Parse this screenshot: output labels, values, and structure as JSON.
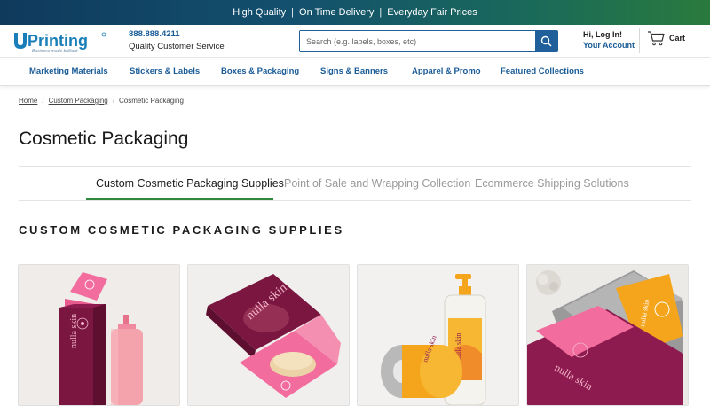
{
  "promo": {
    "items": [
      "High Quality",
      "On Time Delivery",
      "Everyday Fair Prices"
    ],
    "separator": "|"
  },
  "header": {
    "logo_text": "UPrinting",
    "logo_tagline": "Business made brilliant",
    "phone": "888.888.4211",
    "service_text": "Quality Customer Service",
    "search_placeholder": "Search (e.g. labels, boxes, etc)",
    "login_text": "Hi, Log In!",
    "account_text": "Your Account",
    "cart_label": "Cart"
  },
  "nav": {
    "items": [
      "Marketing Materials",
      "Stickers & Labels",
      "Boxes & Packaging",
      "Signs & Banners",
      "Apparel & Promo",
      "Featured Collections"
    ]
  },
  "breadcrumb": {
    "home": "Home",
    "parent": "Custom Packaging",
    "current": "Cosmetic Packaging",
    "separator": "/"
  },
  "page": {
    "title": "Cosmetic Packaging",
    "section_heading": "CUSTOM COSMETIC PACKAGING SUPPLIES"
  },
  "tabs": [
    {
      "label": "Custom Cosmetic Packaging Supplies",
      "active": true
    },
    {
      "label": "Point of Sale and Wrapping Collection",
      "active": false
    },
    {
      "label": "Ecommerce Shipping Solutions",
      "active": false
    }
  ],
  "products": {
    "brand_text": "nulla skin",
    "cards": [
      "box-and-bottle",
      "tuck-box",
      "roll-labels-and-pump",
      "tissue-and-pouch"
    ]
  },
  "colors": {
    "brand_blue": "#1a5c98",
    "accent_green": "#2e8a3a",
    "product_magenta": "#8e1b4f",
    "product_pink": "#f06a9c",
    "product_orange": "#f4a51c"
  }
}
